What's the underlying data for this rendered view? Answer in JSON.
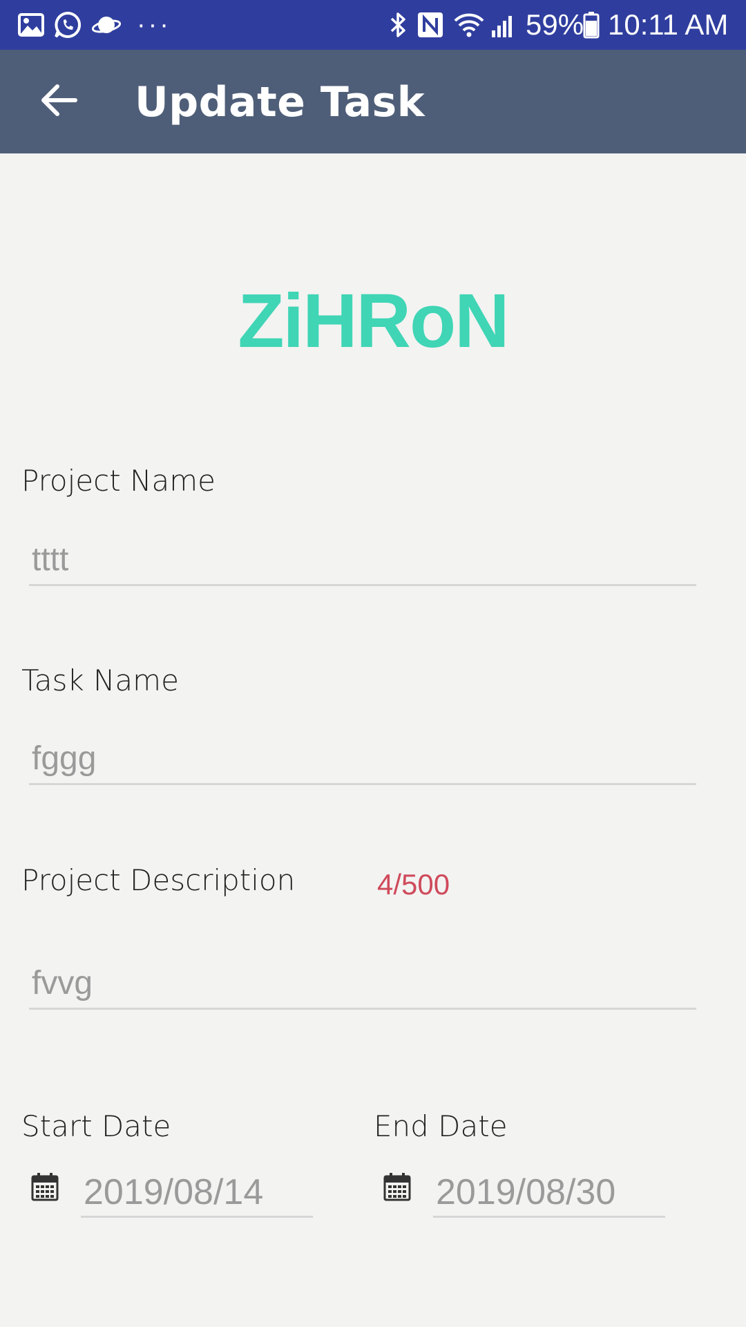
{
  "status_bar": {
    "icons": [
      "gallery-icon",
      "whatsapp-icon",
      "planet-icon",
      "more-dots-icon",
      "bluetooth-icon",
      "nfc-icon",
      "wifi-icon",
      "signal-icon",
      "battery-icon"
    ],
    "more_dots": "···",
    "battery": "59%",
    "time": "10:11 AM",
    "background_color": "#2f3e9e"
  },
  "app_bar": {
    "title": "Update Task",
    "back_icon": "arrow-left-icon",
    "background_color": "#4f5e78"
  },
  "logo": {
    "text": "ZiHRoN",
    "color": "#3fd5b5"
  },
  "form": {
    "project_name": {
      "label": "Project Name",
      "value": "tttt"
    },
    "task_name": {
      "label": "Task Name",
      "value": "fggg"
    },
    "project_description": {
      "label": "Project Description",
      "counter": "4/500",
      "counter_color": "#cf4a5b",
      "value": "fvvg"
    },
    "start_date": {
      "label": "Start Date",
      "icon": "calendar-icon",
      "value": "2019/08/14"
    },
    "end_date": {
      "label": "End Date",
      "icon": "calendar-icon",
      "value": "2019/08/30"
    }
  }
}
